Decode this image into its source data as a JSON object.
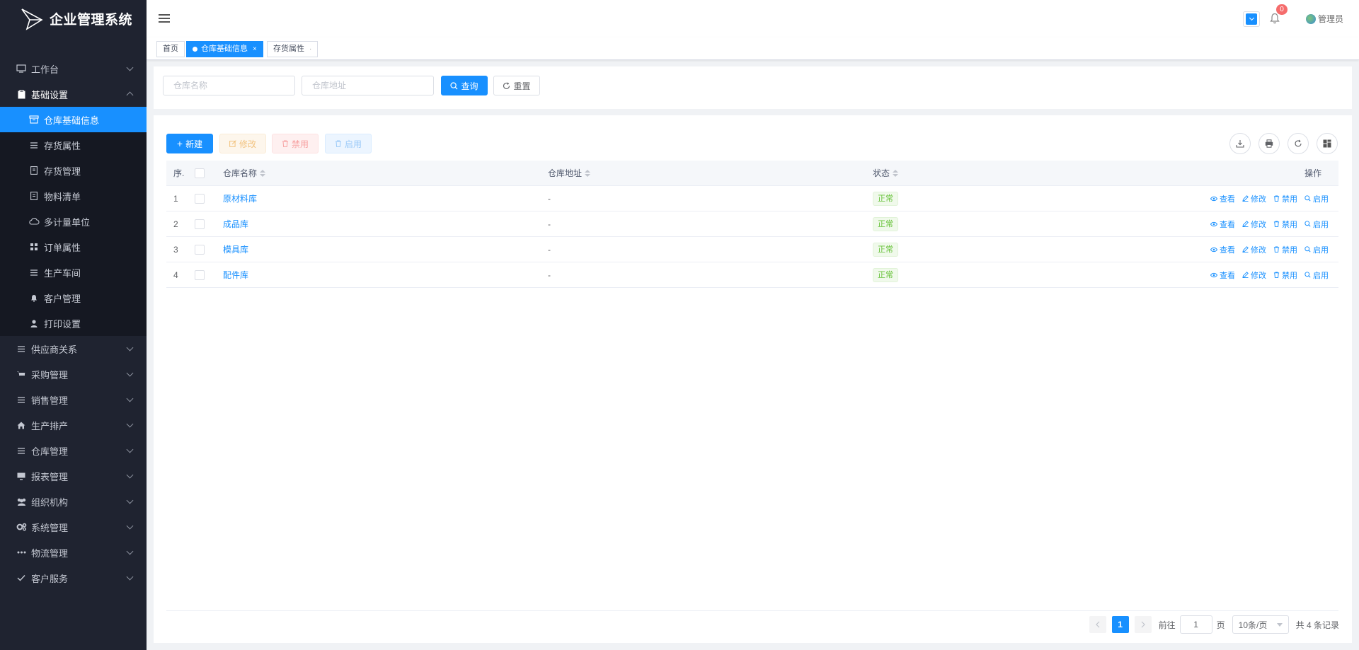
{
  "app": {
    "title": "企业管理系统"
  },
  "colors": {
    "primary": "#1890ff",
    "sidebar": "#1f2330",
    "success": "#67c23a",
    "danger": "#f56c6c"
  },
  "header": {
    "notification_count": "0",
    "user_name": "管理员"
  },
  "tabs": [
    {
      "label": "首页"
    },
    {
      "label": "仓库基础信息",
      "active": true,
      "close": "×"
    },
    {
      "label": "存货属性",
      "close": "·"
    }
  ],
  "menu": {
    "workbench": "工作台",
    "basic_settings": "基础设置",
    "sub": {
      "warehouse_info": "仓库基础信息",
      "inventory_attr": "存货属性",
      "inventory_mgmt": "存货管理",
      "bom": "物料清单",
      "multi_unit": "多计量单位",
      "order_attr": "订单属性",
      "workshop": "生产车间",
      "customer_mgmt": "客户管理",
      "print_settings": "打印设置"
    },
    "supplier": "供应商关系",
    "purchase": "采购管理",
    "sales": "销售管理",
    "production": "生产排产",
    "warehouse": "仓库管理",
    "reports": "报表管理",
    "org": "组织机构",
    "system": "系统管理",
    "logistics": "物流管理",
    "customer_service": "客户服务"
  },
  "search": {
    "name_placeholder": "仓库名称",
    "addr_placeholder": "仓库地址",
    "query_label": "查询",
    "reset_label": "重置"
  },
  "toolbar": {
    "new": "新建",
    "edit": "修改",
    "disable": "禁用",
    "enable": "启用"
  },
  "table": {
    "headers": {
      "index": "序.",
      "name": "仓库名称",
      "address": "仓库地址",
      "status": "状态",
      "ops": "操作"
    },
    "op_labels": {
      "view": "查看",
      "edit": "修改",
      "disable": "禁用",
      "enable": "启用"
    },
    "rows": [
      {
        "index": "1",
        "name": "原材料库",
        "address": "-",
        "status": "正常"
      },
      {
        "index": "2",
        "name": "成品库",
        "address": "-",
        "status": "正常"
      },
      {
        "index": "3",
        "name": "模具库",
        "address": "-",
        "status": "正常"
      },
      {
        "index": "4",
        "name": "配件库",
        "address": "-",
        "status": "正常"
      }
    ]
  },
  "pager": {
    "current": "1",
    "goto_prefix": "前往",
    "goto_value": "1",
    "goto_suffix": "页",
    "page_size": "10条/页",
    "total": "共 4 条记录"
  }
}
